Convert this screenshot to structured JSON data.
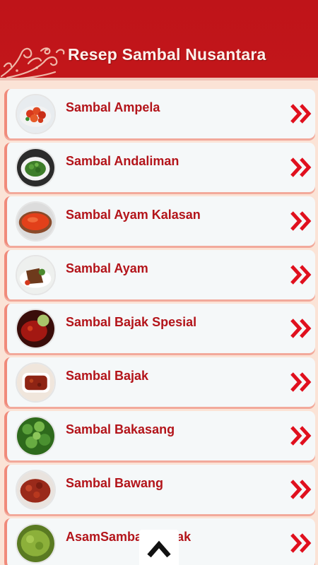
{
  "app": {
    "title": "Resep Sambal Nusantara",
    "accent": "#bf1419",
    "label_color": "#b3141a",
    "background": "#fbe3d6"
  },
  "recipes": [
    {
      "label": "Sambal Ampela",
      "thumb": "red-chili-dish"
    },
    {
      "label": "Sambal Andaliman",
      "thumb": "green-herb-dish"
    },
    {
      "label": "Sambal Ayam Kalasan",
      "thumb": "red-sauce-bowl"
    },
    {
      "label": "Sambal Ayam",
      "thumb": "fried-chicken-plate"
    },
    {
      "label": "Sambal Bajak Spesial",
      "thumb": "dark-red-sambal"
    },
    {
      "label": "Sambal Bajak",
      "thumb": "brown-sambal-dish"
    },
    {
      "label": "Sambal Bakasang",
      "thumb": "green-vegetable-dish"
    },
    {
      "label": "Sambal Bawang",
      "thumb": "red-onion-sambal"
    },
    {
      "label": "AsamSambal Bladak",
      "thumb": "green-chili-sambal"
    }
  ],
  "icons": {
    "item_action": "double-chevron-right-icon",
    "scroll_top": "chevron-up-icon"
  }
}
